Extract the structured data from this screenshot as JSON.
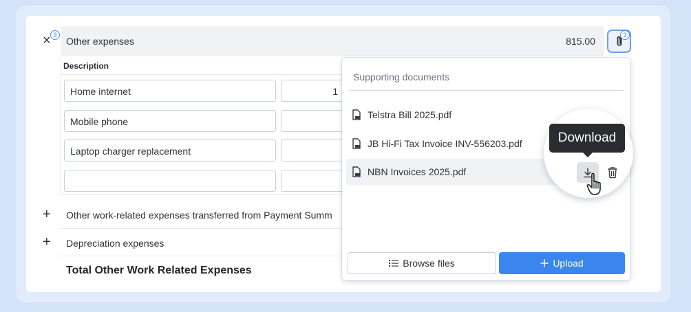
{
  "section": {
    "label": "Other expenses",
    "amount": "815.00",
    "badge_count": "3",
    "attachment_badge_count": "3"
  },
  "table": {
    "column_header": "Description",
    "rows": [
      {
        "description": "Home internet",
        "amount_partial": "1"
      },
      {
        "description": "Mobile phone",
        "amount_partial": ""
      },
      {
        "description": "Laptop charger replacement",
        "amount_partial": ""
      },
      {
        "description": "",
        "amount_partial": ""
      }
    ]
  },
  "collapsed_rows": [
    {
      "label": "Other work-related expenses transferred from Payment Summ"
    },
    {
      "label": "Depreciation expenses"
    }
  ],
  "total_label": "Total Other Work Related Expenses",
  "popover": {
    "title": "Supporting documents",
    "documents": [
      {
        "name": "Telstra Bill 2025.pdf"
      },
      {
        "name": "JB Hi-Fi Tax Invoice INV-556203.pdf"
      },
      {
        "name": "NBN Invoices 2025.pdf"
      }
    ],
    "browse_label": "Browse files",
    "upload_label": "Upload"
  },
  "tooltip": "Download",
  "icons": {
    "close": "close-icon",
    "add": "plus-icon",
    "attachment": "paperclip-icon",
    "document": "pdf-file-icon",
    "download": "download-icon",
    "delete": "trash-icon",
    "list": "list-icon",
    "cursor": "hand-pointer-icon"
  },
  "colors": {
    "accent": "#3b86ee",
    "badge": "#4b8ff3",
    "tooltip_bg": "#2b2c2f",
    "page_bg": "#d4e3f8"
  }
}
